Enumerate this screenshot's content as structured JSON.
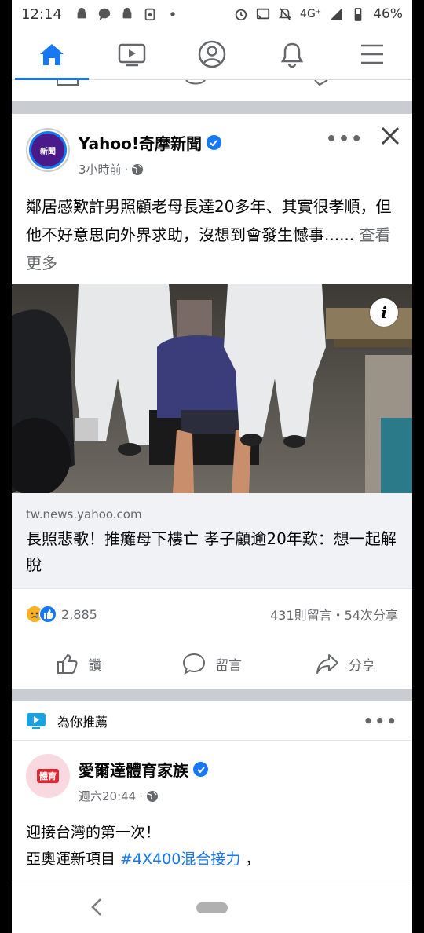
{
  "status_bar": {
    "time": "12:14",
    "network": "4G⁺",
    "battery": "46%"
  },
  "nav": {
    "items": [
      {
        "name": "home",
        "active": true
      },
      {
        "name": "watch"
      },
      {
        "name": "profile"
      },
      {
        "name": "notifications"
      },
      {
        "name": "menu"
      }
    ]
  },
  "post": {
    "page_name": "Yahoo!奇摩新聞",
    "time": "3小時前",
    "avatar_text": "新聞",
    "text": "鄰居感歎許男照顧老母長達20多年、其實很孝順，但他不好意思向外界求助，沒想到會發生憾事......",
    "see_more": "查看更多",
    "link_domain": "tw.news.yahoo.com",
    "link_title": "長照悲歌！推癱母下樓亡 孝子顧逾20年歎：想一起解脫",
    "reaction_count": "2,885",
    "stats": "431則留言・54次分享",
    "like_label": "讚",
    "comment_label": "留言",
    "share_label": "分享"
  },
  "recommended": {
    "label": "為你推薦"
  },
  "post2": {
    "page_name": "愛爾達體育家族",
    "time": "週六20:44",
    "avatar_text": "體育",
    "line1": "迎接台灣的第一次！",
    "line2_prefix": "亞奧運新項目 ",
    "hashtag": "#4X400混合接力",
    "line2_suffix": " ，"
  },
  "colors": {
    "accent": "#1877f2",
    "secondary_text": "#65676b",
    "separator": "#c9ccd1"
  }
}
